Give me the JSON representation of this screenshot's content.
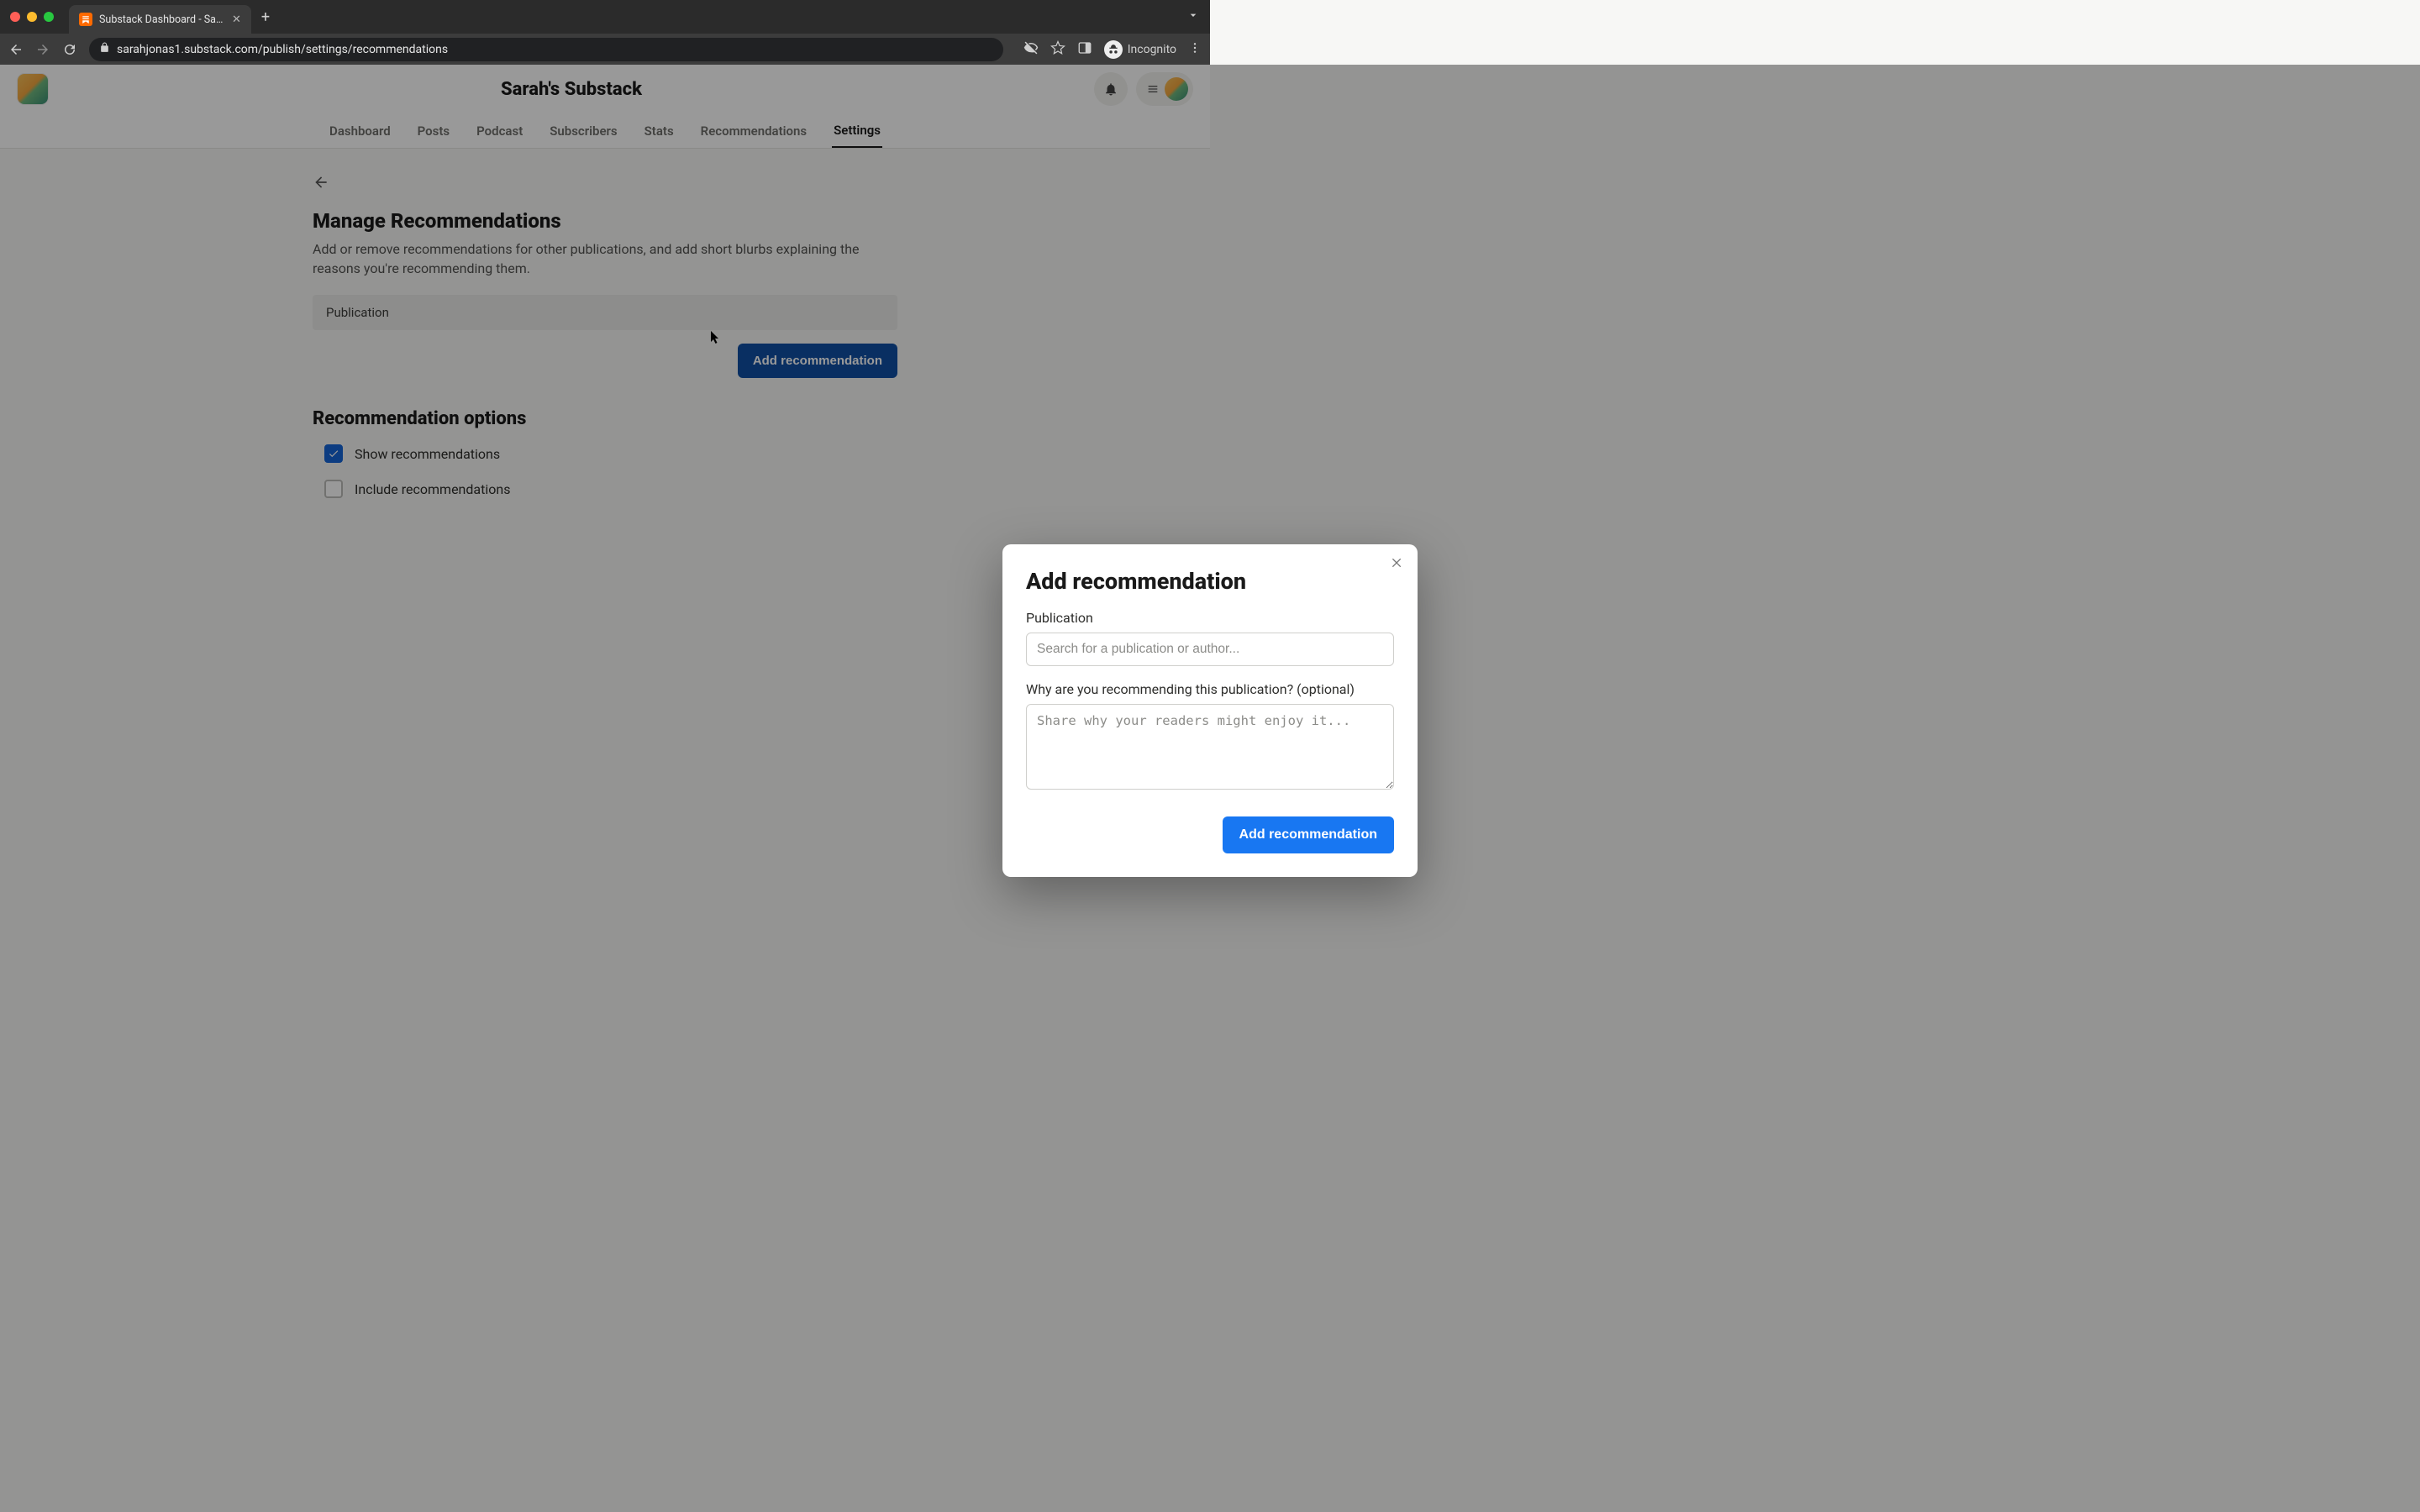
{
  "browser": {
    "tab_title": "Substack Dashboard - Sarah's",
    "url": "sarahjonas1.substack.com/publish/settings/recommendations",
    "incognito_label": "Incognito"
  },
  "header": {
    "publication_name": "Sarah's Substack"
  },
  "nav": {
    "items": [
      "Dashboard",
      "Posts",
      "Podcast",
      "Subscribers",
      "Stats",
      "Recommendations",
      "Settings"
    ],
    "active_index": 6
  },
  "page": {
    "title": "Manage Recommendations",
    "subtitle": "Add or remove recommendations for other publications, and add short blurbs explaining the reasons you're recommending them.",
    "table_header": "Publication",
    "add_button": "Add recommendation",
    "options_title": "Recommendation options",
    "options": [
      {
        "label": "Show recommendations",
        "checked": true
      },
      {
        "label": "Include recommendations",
        "checked": false
      }
    ]
  },
  "modal": {
    "title": "Add recommendation",
    "publication_label": "Publication",
    "publication_placeholder": "Search for a publication or author...",
    "reason_label": "Why are you recommending this publication? (optional)",
    "reason_placeholder": "Share why your readers might enjoy it...",
    "submit_label": "Add recommendation"
  }
}
